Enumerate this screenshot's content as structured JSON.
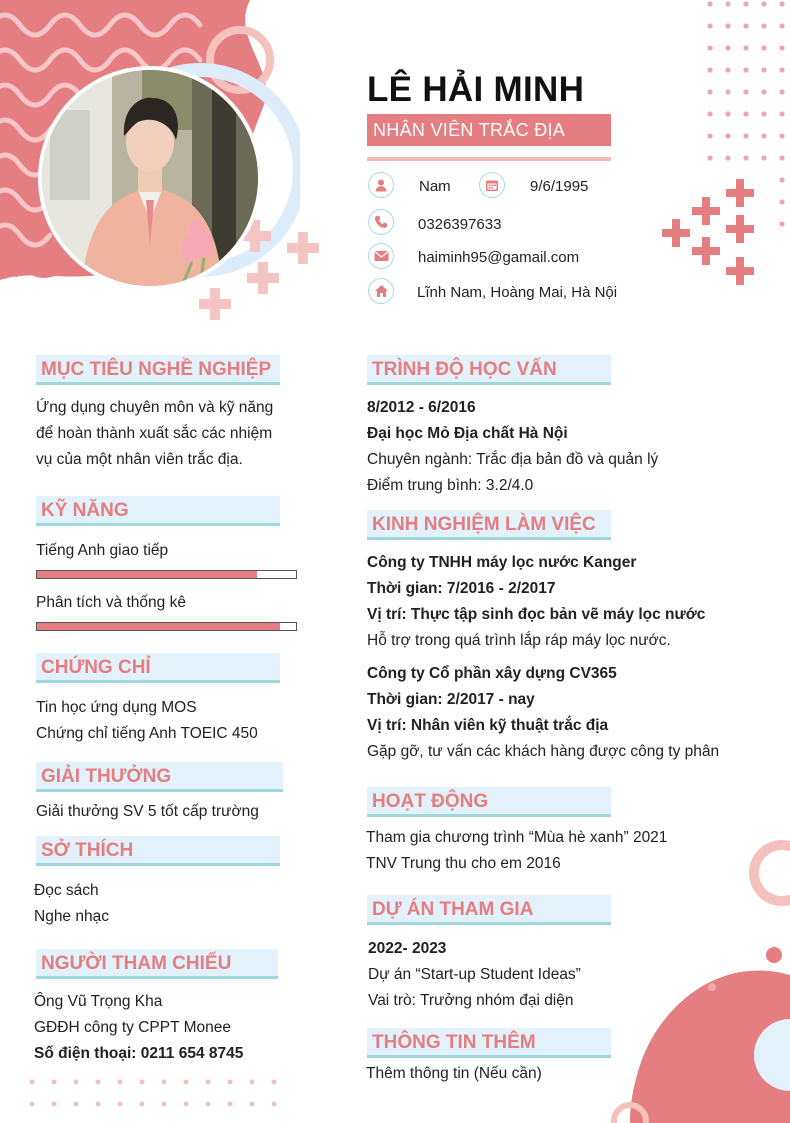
{
  "header": {
    "name": "LÊ HẢI MINH",
    "job_title": "NHÂN VIÊN TRẮC ĐỊA",
    "gender": "Nam",
    "birthday": "9/6/1995",
    "phone": "0326397633",
    "email": "haiminh95@gamail.com",
    "address": "Lĩnh Nam, Hoàng Mai, Hà Nội"
  },
  "left": {
    "objective": {
      "heading": "MỤC TIÊU NGHỀ NGHIỆP",
      "lines": [
        "Ứng dụng chuyên môn và kỹ năng",
        "để hoàn thành xuất sắc các nhiệm",
        "vụ của một nhân viên trắc địa."
      ]
    },
    "skills": {
      "heading": "KỸ NĂNG",
      "items": [
        {
          "label": "Tiếng Anh giao tiếp",
          "level": 0.85
        },
        {
          "label": "Phân tích và thống kê",
          "level": 0.94
        }
      ]
    },
    "certificates": {
      "heading": "CHỨNG CHỈ",
      "items": [
        "Tin học ứng dụng MOS",
        "Chứng chỉ tiếng Anh TOEIC 450"
      ]
    },
    "awards": {
      "heading": "GIẢI THƯỞNG",
      "items": [
        "Giải thưởng SV 5 tốt cấp trường"
      ]
    },
    "hobbies": {
      "heading": "SỞ THÍCH",
      "items": [
        "Đọc sách",
        "Nghe nhạc"
      ]
    },
    "references": {
      "heading": "NGƯỜI THAM CHIẾU",
      "name": "Ông Vũ Trọng Kha",
      "position": "GĐĐH công ty CPPT Monee",
      "phone": "Số điện thoại: 0211 654 8745"
    }
  },
  "right": {
    "education": {
      "heading": "TRÌNH ĐỘ HỌC VẤN",
      "period": "8/2012 - 6/2016",
      "school": "Đại học Mỏ Địa chất Hà Nội",
      "major": "Chuyên ngành: Trắc địa bản đồ và quản lý",
      "gpa": "Điểm trung bình: 3.2/4.0"
    },
    "experience": {
      "heading": "KINH NGHIỆM LÀM VIỆC",
      "jobs": [
        {
          "company": "Công ty TNHH máy lọc nước Kanger",
          "time": "Thời gian: 7/2016 - 2/2017",
          "role": "Vị trí: Thực tập sinh đọc bản vẽ máy lọc nước",
          "desc": "Hỗ trợ trong quá trình lắp ráp máy lọc nước."
        },
        {
          "company": "Công ty Cổ phần xây dựng CV365",
          "time": "Thời gian: 2/2017 - nay",
          "role": "Vị trí: Nhân viên kỹ thuật trắc địa",
          "desc": "Gặp gỡ, tư vấn các khách hàng được công ty phân"
        }
      ]
    },
    "activities": {
      "heading": "HOẠT ĐỘNG",
      "items": [
        "Tham gia chương trình “Mùa hè xanh” 2021",
        "TNV Trung thu cho em 2016"
      ]
    },
    "projects": {
      "heading": "DỰ ÁN THAM GIA",
      "period": "2022- 2023",
      "project": "Dự án “Start-up Student Ideas”",
      "role": "Vai trò: Trưởng nhóm đại diện"
    },
    "extra": {
      "heading": "THÔNG TIN THÊM",
      "text": "Thêm thông tin (Nếu cần)"
    }
  },
  "colors": {
    "accent": "#e57e80",
    "accent_light": "#f4b9bf",
    "heading_bg": "#e3f1fb",
    "heading_line": "#9ed7dc"
  },
  "icons": [
    "user-icon",
    "calendar-icon",
    "phone-icon",
    "mail-icon",
    "home-icon"
  ]
}
